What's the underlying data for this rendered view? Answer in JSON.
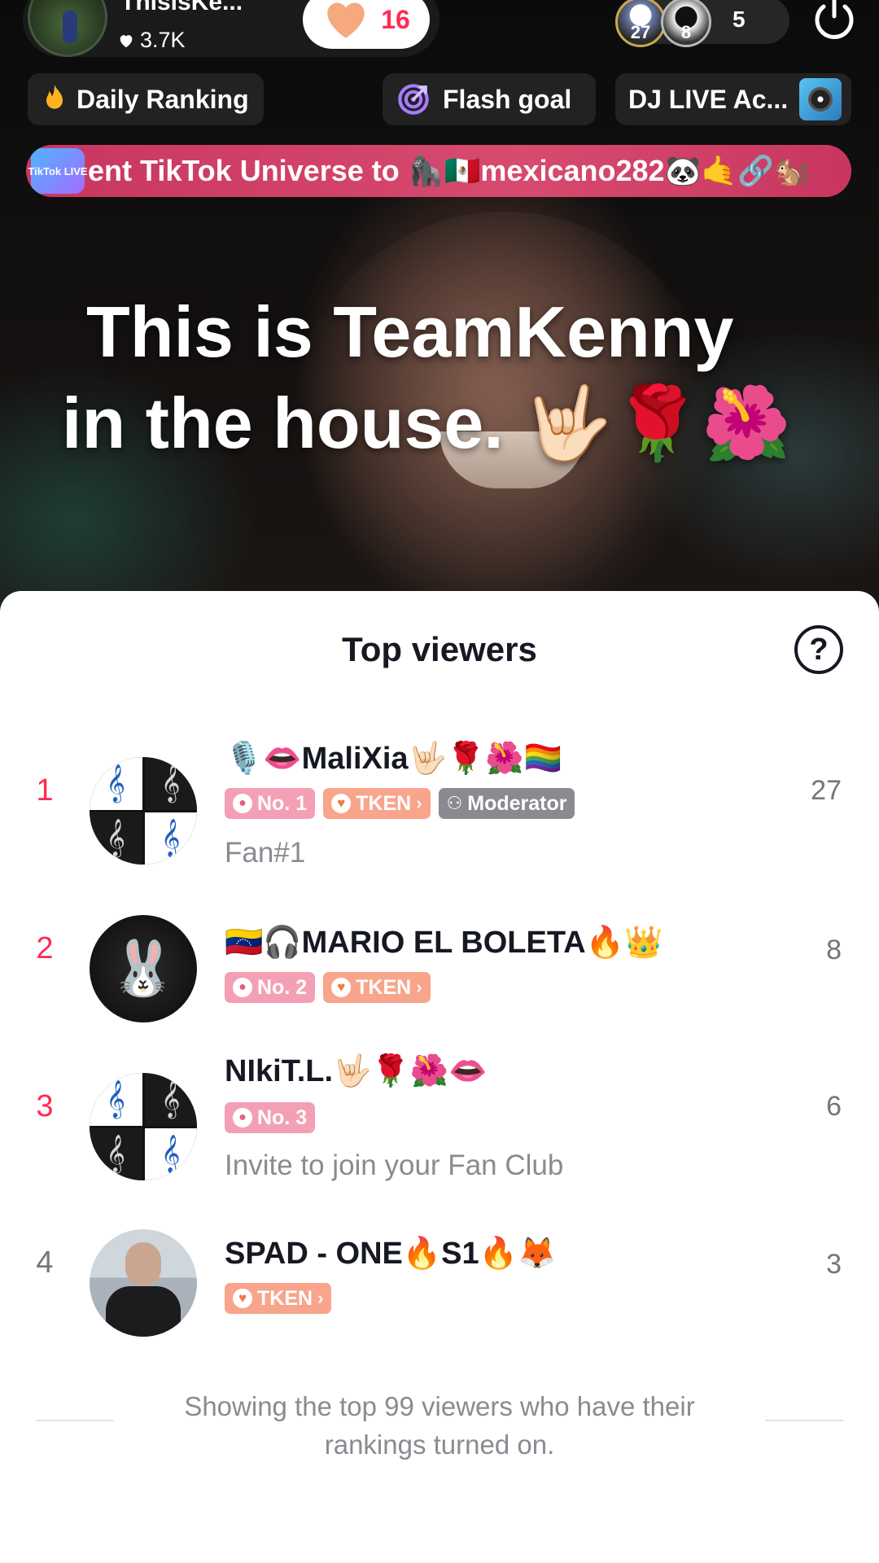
{
  "host": {
    "name": "ThisisKe...",
    "likes": "3.7K",
    "follow_count": "16"
  },
  "viewers": {
    "badge_1": "27",
    "badge_2": "8",
    "count": "5"
  },
  "pills": {
    "daily_ranking": "Daily Ranking",
    "flash_goal": "Flash goal",
    "dj_live": "DJ LIVE Ac..."
  },
  "banner": {
    "badge_text": "TikTok LIVE",
    "text": "ent TikTok Universe to 🦍🇲🇽mexicano282🐼🤙🔗🐿️"
  },
  "caption": {
    "line1": "This is TeamKenny",
    "line2": "in the house. 🤟🏻🌹🌺"
  },
  "sheet": {
    "title": "Top viewers",
    "help": "?",
    "footer": "Showing the top 99 viewers who have their rankings turned on."
  },
  "top_viewers": [
    {
      "rank": "1",
      "name": "🎙️👄MaliXia🤟🏻🌹🌺🏳️‍🌈",
      "rank_badge": "No. 1",
      "fan_badge": "TKEN",
      "mod_badge": "Moderator",
      "subtext": "Fan#1",
      "score": "27"
    },
    {
      "rank": "2",
      "name": "🇻🇪🎧MARIO EL BOLETA🔥👑",
      "rank_badge": "No. 2",
      "fan_badge": "TKEN",
      "score": "8"
    },
    {
      "rank": "3",
      "name": "NIkiT.L.🤟🏻🌹🌺👄",
      "rank_badge": "No. 3",
      "subtext": "Invite to join your Fan Club",
      "score": "6"
    },
    {
      "rank": "4",
      "name": "SPAD - ONE🔥S1🔥🦊",
      "fan_badge": "TKEN",
      "score": "3"
    }
  ],
  "colors": {
    "accent": "#fe2c55",
    "banner": "#d84a6e",
    "rank_badge": "#f4a0b4",
    "fan_badge": "#f8a58c",
    "mod_badge": "#8a8b91"
  },
  "icons": {
    "heart": "heart-icon",
    "power": "power-icon",
    "fire": "fire-icon",
    "target": "target-icon",
    "help": "help-icon"
  }
}
